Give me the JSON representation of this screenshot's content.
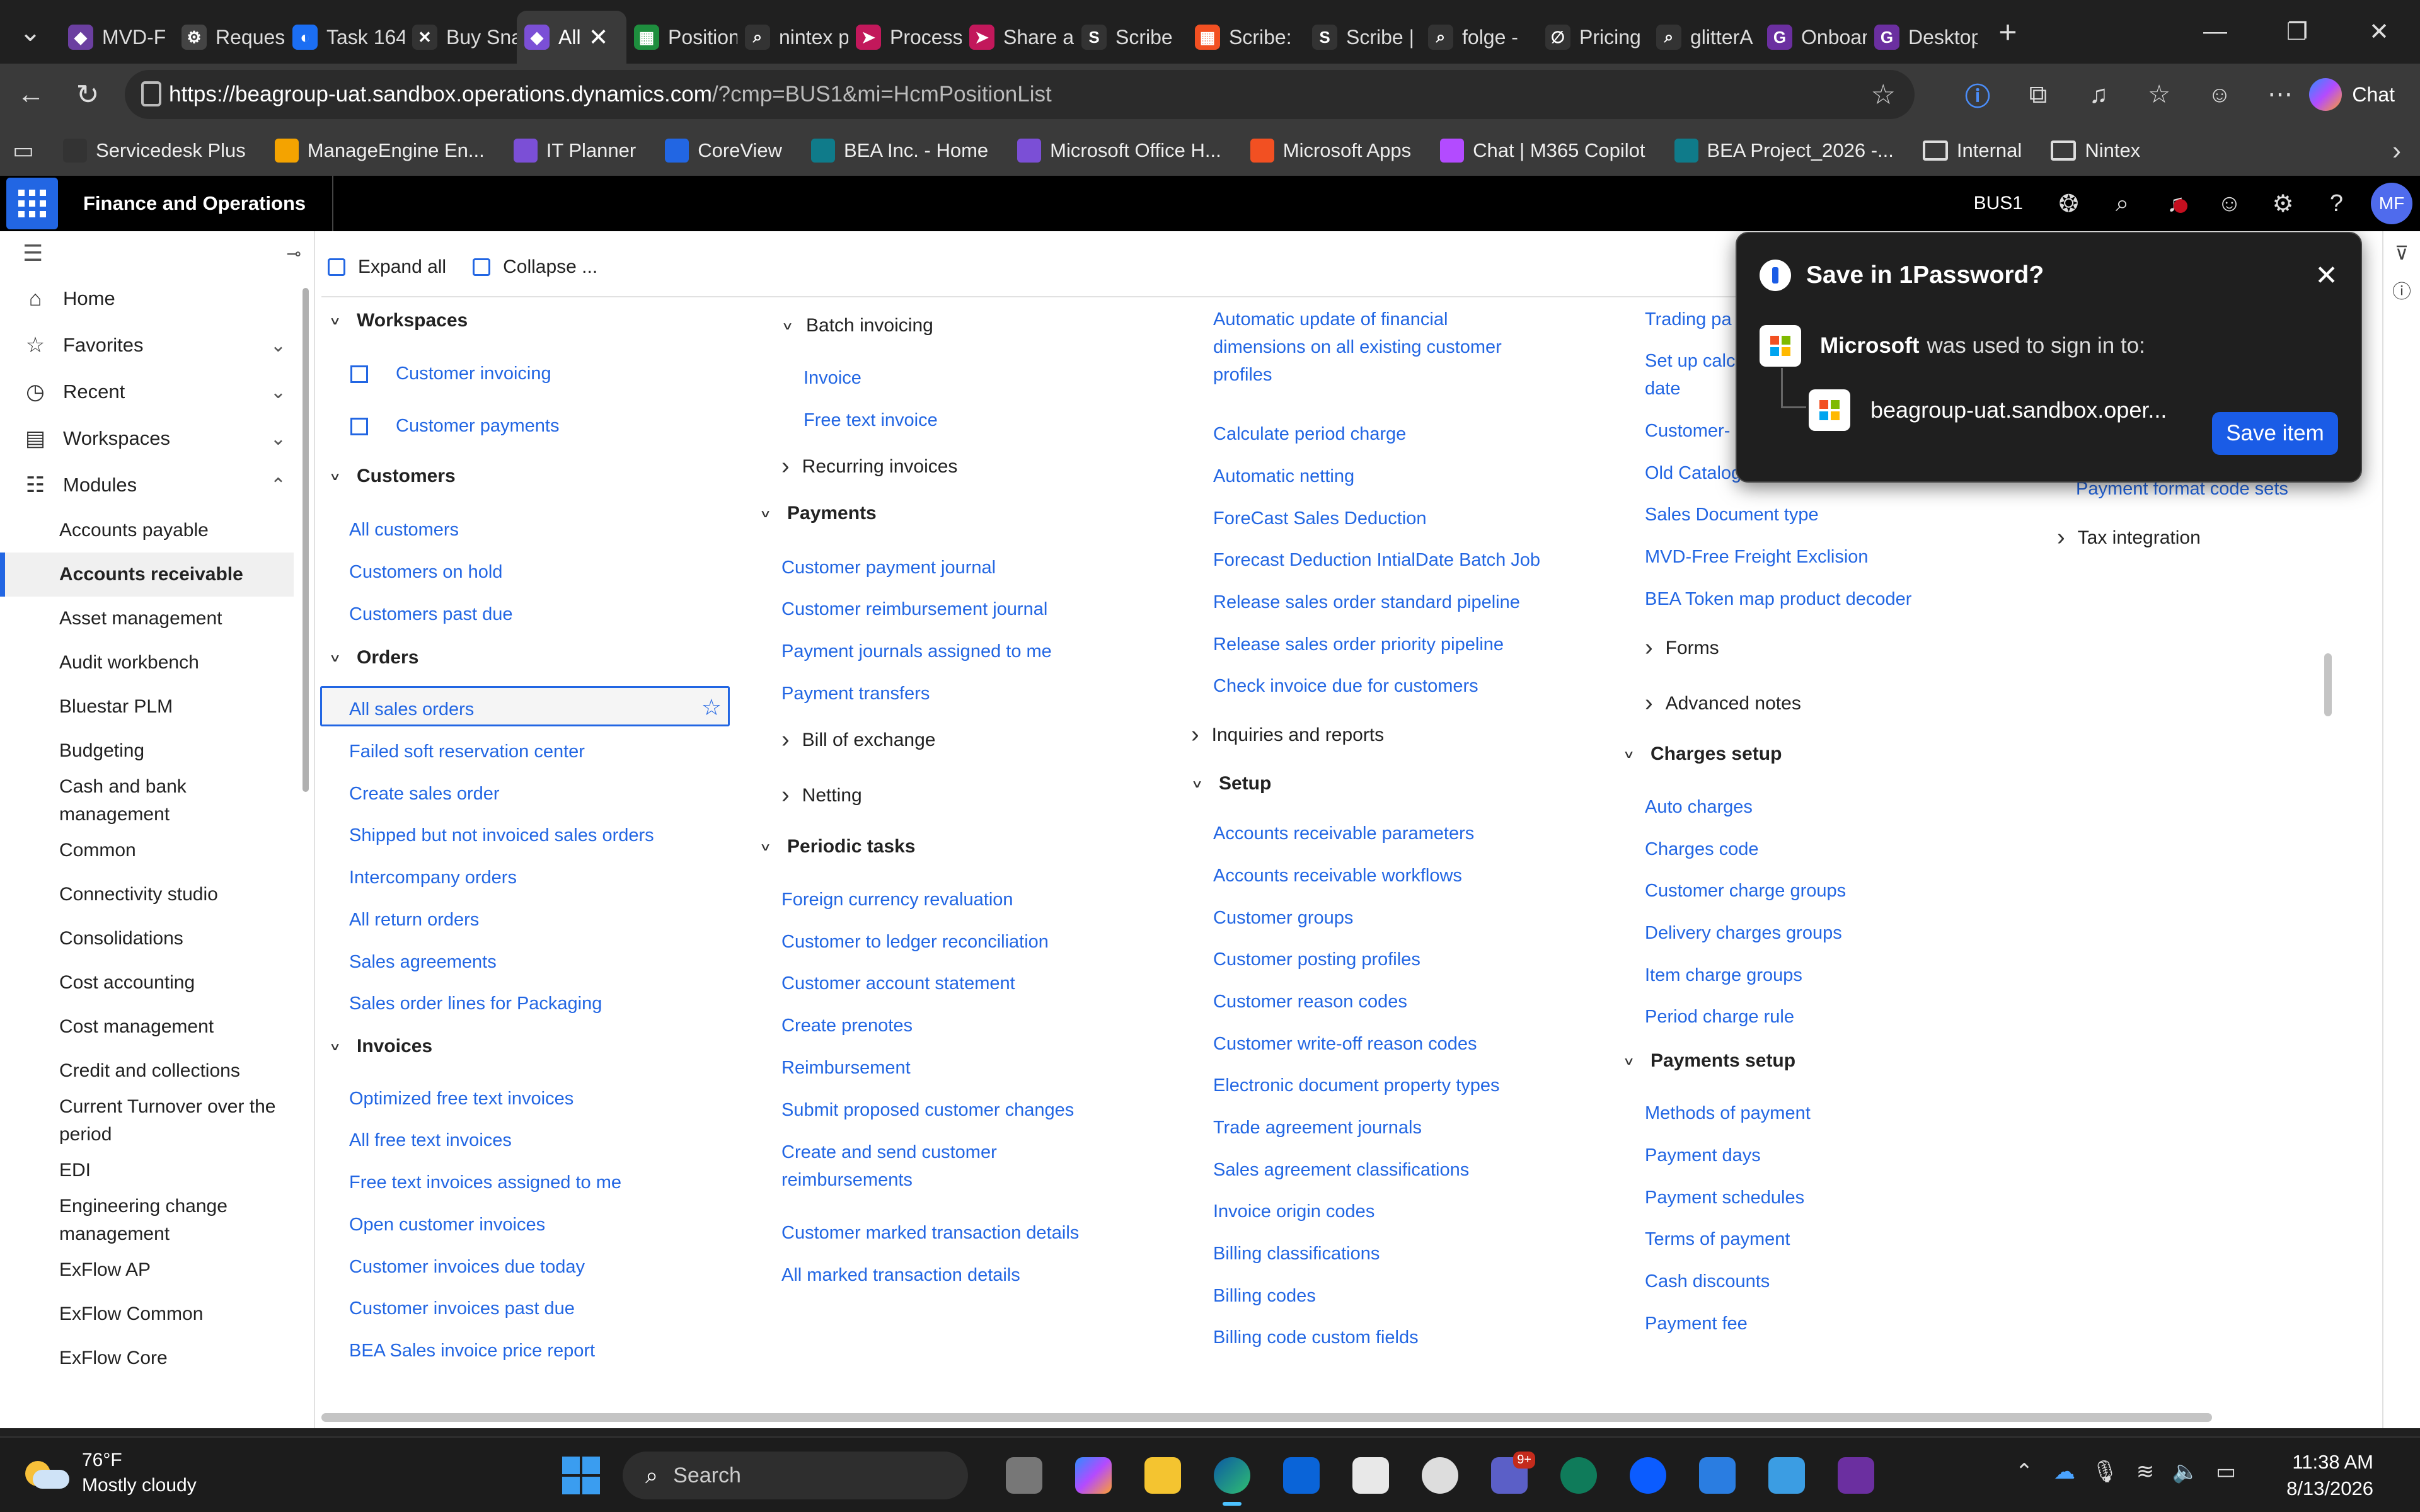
{
  "browser": {
    "tabs": [
      {
        "label": "MVD-F",
        "color": "#6b3fa0",
        "glyph": "◆"
      },
      {
        "label": "Request",
        "color": "#444",
        "glyph": "⚙"
      },
      {
        "label": "Task 164",
        "color": "#1b6ef3",
        "glyph": "◐"
      },
      {
        "label": "Buy Sna",
        "color": "#333",
        "glyph": "✕"
      },
      {
        "label": "All",
        "color": "#7b4fd6",
        "glyph": "◆",
        "active": true
      },
      {
        "label": "Position",
        "color": "#1e8e3e",
        "glyph": "▦"
      },
      {
        "label": "nintex p",
        "color": "#333",
        "glyph": "⌕"
      },
      {
        "label": "Process",
        "color": "#c2185b",
        "glyph": "➤"
      },
      {
        "label": "Share a",
        "color": "#c2185b",
        "glyph": "➤"
      },
      {
        "label": "Scribe",
        "color": "#333",
        "glyph": "S"
      },
      {
        "label": "Scribe:",
        "color": "#f25022",
        "glyph": "▦"
      },
      {
        "label": "Scribe |",
        "color": "#333",
        "glyph": "S"
      },
      {
        "label": "folge -",
        "color": "#333",
        "glyph": "⌕"
      },
      {
        "label": "Pricing",
        "color": "#333",
        "glyph": "∅"
      },
      {
        "label": "glitterA",
        "color": "#333",
        "glyph": "⌕"
      },
      {
        "label": "Onboar",
        "color": "#6b2fa0",
        "glyph": "G"
      },
      {
        "label": "Desktop",
        "color": "#6b2fa0",
        "glyph": "G"
      }
    ],
    "url_host": "https://beagroup-uat.sandbox.operations.dynamics.com",
    "url_path": "/?cmp=BUS1&mi=HcmPositionList",
    "chat_label": "Chat",
    "bookmarks": [
      {
        "label": "Servicedesk Plus",
        "color": "#333"
      },
      {
        "label": "ManageEngine En...",
        "color": "#f4a300"
      },
      {
        "label": "IT Planner",
        "color": "#7b4fd6"
      },
      {
        "label": "CoreView",
        "color": "#2266e3"
      },
      {
        "label": "BEA Inc. - Home",
        "color": "#0f7b8a"
      },
      {
        "label": "Microsoft Office H...",
        "color": "#7b4fd6"
      },
      {
        "label": "Microsoft Apps",
        "color": "#f25022"
      },
      {
        "label": "Chat | M365 Copilot",
        "color": "#b34bff"
      },
      {
        "label": "BEA Project_2026 -...",
        "color": "#0f7b8a"
      },
      {
        "label": "Internal",
        "folder": true
      },
      {
        "label": "Nintex",
        "folder": true
      }
    ]
  },
  "d365": {
    "app_name": "Finance and Operations",
    "company": "BUS1",
    "user_initials": "MF"
  },
  "nav": {
    "home": "Home",
    "favorites": "Favorites",
    "recent": "Recent",
    "workspaces": "Workspaces",
    "modules": "Modules",
    "module_items": [
      "Accounts payable",
      "Accounts receivable",
      "Asset management",
      "Audit workbench",
      "Bluestar PLM",
      "Budgeting",
      "Cash and bank management",
      "Common",
      "Connectivity studio",
      "Consolidations",
      "Cost accounting",
      "Cost management",
      "Credit and collections",
      "Current Turnover over the period",
      "EDI",
      "Engineering change management",
      "ExFlow AP",
      "ExFlow Common",
      "ExFlow Core"
    ]
  },
  "toolbar": {
    "expand_all": "Expand all",
    "collapse": "Collapse ..."
  },
  "col1": {
    "workspaces": "Workspaces",
    "ws_items": [
      "Customer invoicing",
      "Customer payments"
    ],
    "customers": "Customers",
    "cust_items": [
      "All customers",
      "Customers on hold",
      "Customers past due"
    ],
    "orders": "Orders",
    "order_items": [
      "All sales orders",
      "Failed soft reservation center",
      "Create sales order",
      "Shipped but not invoiced sales orders",
      "Intercompany orders",
      "All return orders",
      "Sales agreements",
      "Sales order lines for Packaging"
    ],
    "invoices": "Invoices",
    "invoice_items": [
      "Optimized free text invoices",
      "All free text invoices",
      "Free text invoices assigned to me",
      "Open customer invoices",
      "Customer invoices due today",
      "Customer invoices past due",
      "BEA Sales invoice price report"
    ]
  },
  "col2": {
    "batch_invoicing": "Batch invoicing",
    "batch_items": [
      "Invoice",
      "Free text invoice"
    ],
    "recurring_invoices": "Recurring invoices",
    "payments": "Payments",
    "payment_items": [
      "Customer payment journal",
      "Customer reimbursement journal",
      "Payment journals assigned to me",
      "Payment transfers"
    ],
    "bill_of_exchange": "Bill of exchange",
    "netting": "Netting",
    "periodic_tasks": "Periodic tasks",
    "periodic_items": [
      "Foreign currency revaluation",
      "Customer to ledger reconciliation",
      "Customer account statement",
      "Create prenotes",
      "Reimbursement",
      "Submit proposed customer changes",
      "Create and send customer reimbursements",
      "Customer marked transaction details",
      "All marked transaction details"
    ]
  },
  "col3": {
    "top_items": [
      "Automatic update of financial dimensions on all existing customer profiles",
      "Calculate period charge",
      "Automatic netting",
      "ForeCast Sales Deduction",
      "Forecast Deduction IntialDate Batch Job",
      "Release sales order standard pipeline",
      "Release sales order priority pipeline",
      "Check invoice due for customers"
    ],
    "inquiries": "Inquiries and reports",
    "setup": "Setup",
    "setup_items": [
      "Accounts receivable parameters",
      "Accounts receivable workflows",
      "Customer groups",
      "Customer posting profiles",
      "Customer reason codes",
      "Customer write-off reason codes",
      "Electronic document property types",
      "Trade agreement journals",
      "Sales agreement classifications",
      "Invoice origin codes",
      "Billing classifications",
      "Billing codes",
      "Billing code custom fields"
    ]
  },
  "col4": {
    "top_items": [
      "Trading pa",
      "Set up calc",
      "date",
      "Customer-",
      "Old Catalog",
      "Sales Document type",
      "MVD-Free Freight Exclision",
      "BEA Token map product decoder"
    ],
    "forms": "Forms",
    "advanced_notes": "Advanced notes",
    "charges_setup": "Charges setup",
    "charges_items": [
      "Auto charges",
      "Charges code",
      "Customer charge groups",
      "Delivery charges groups",
      "Item charge groups",
      "Period charge rule"
    ],
    "payments_setup": "Payments setup",
    "payments_items": [
      "Methods of payment",
      "Payment days",
      "Payment schedules",
      "Terms of payment",
      "Cash discounts",
      "Payment fee"
    ]
  },
  "col5": {
    "payment_format": "Payment format code sets",
    "tax_integration": "Tax integration"
  },
  "popup": {
    "title": "Save in 1Password?",
    "brand": "Microsoft",
    "used_text": "was used to sign in to:",
    "site": "beagroup-uat.sandbox.oper...",
    "save_button": "Save item"
  },
  "taskbar": {
    "temp": "76°F",
    "weather": "Mostly cloudy",
    "search": "Search",
    "time": "11:38 AM",
    "date": "8/13/2026",
    "teams_badge": "9+"
  }
}
